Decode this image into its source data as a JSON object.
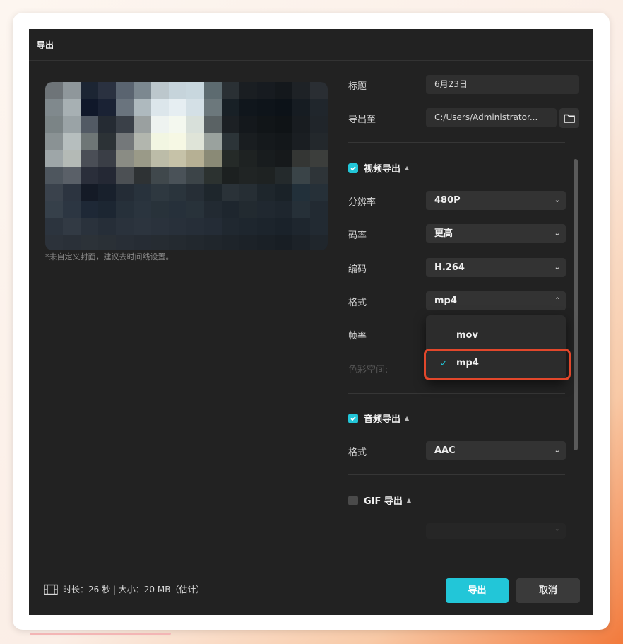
{
  "dialog": {
    "title": "导出"
  },
  "preview": {
    "cover_hint": "*未自定义封面，建议去时间线设置。",
    "pixels": [
      "#6e7478",
      "#8f979b",
      "#1c2533",
      "#2a3140",
      "#5a6470",
      "#7c8890",
      "#bcc7cc",
      "#c6d4db",
      "#c8d7de",
      "#5d6b70",
      "#2a3034",
      "#1a1e22",
      "#171b20",
      "#14181c",
      "#1e2226",
      "#2a2e33",
      "#80898d",
      "#a7b0b3",
      "#10182a",
      "#1a2234",
      "#6a747e",
      "#aeb9be",
      "#dce6eb",
      "#e6eef2",
      "#d4e0e6",
      "#6c787c",
      "#182026",
      "#10161c",
      "#0e141a",
      "#0c1218",
      "#161c22",
      "#20262c",
      "#7b8486",
      "#9aa3a6",
      "#525a64",
      "#252b33",
      "#3a4048",
      "#9aa0a0",
      "#eef3f0",
      "#f4f8ef",
      "#d8e0da",
      "#5a6264",
      "#1c2024",
      "#14181c",
      "#111518",
      "#0f1316",
      "#181c20",
      "#20252a",
      "#8a9294",
      "#b6bebe",
      "#6e7676",
      "#2c3236",
      "#74787a",
      "#b2b6ae",
      "#f2f6e2",
      "#f6f8e4",
      "#dfe4d8",
      "#9aa29e",
      "#2c3438",
      "#191d20",
      "#15191c",
      "#13171a",
      "#1a1e22",
      "#23282c",
      "#9ea6a8",
      "#b4bab6",
      "#4a4e56",
      "#3a3e46",
      "#8a8c84",
      "#9a9a88",
      "#bcbca8",
      "#c6c2a8",
      "#b6b094",
      "#8a8a76",
      "#252a28",
      "#1e2222",
      "#181c1e",
      "#16191b",
      "#343634",
      "#3c3e3c",
      "#4e565e",
      "#5a6068",
      "#2a2e3a",
      "#242834",
      "#4c5054",
      "#2e3234",
      "#40484c",
      "#4a5258",
      "#3c4448",
      "#2c3230",
      "#1c2020",
      "#202424",
      "#1e2222",
      "#242a2c",
      "#3a4448",
      "#2e3438",
      "#3a424c",
      "#2c3440",
      "#141a26",
      "#18202c",
      "#242c36",
      "#28323c",
      "#2e3840",
      "#2a343c",
      "#262e36",
      "#1e262c",
      "#2a3238",
      "#262e34",
      "#1e262c",
      "#1a2228",
      "#22303a",
      "#263038",
      "#36404a",
      "#2c3642",
      "#1e2836",
      "#1c2632",
      "#26303a",
      "#2a343e",
      "#28323a",
      "#26303a",
      "#28323a",
      "#222a32",
      "#1e262e",
      "#222a30",
      "#202830",
      "#1e262e",
      "#263038",
      "#222a32",
      "#2c343e",
      "#323a44",
      "#2a323c",
      "#262e38",
      "#2a323c",
      "#2c343e",
      "#2a323c",
      "#28303a",
      "#262e38",
      "#242c36",
      "#202830",
      "#1e262e",
      "#1c242c",
      "#1a222a",
      "#1e262e",
      "#222a32",
      "#2c323a",
      "#2a3038",
      "#2c3238",
      "#2a3036",
      "#282e36",
      "#262c34",
      "#262c32",
      "#242a30",
      "#22282e",
      "#20262c",
      "#1e242a",
      "#1c2228",
      "#1a2026",
      "#181e24",
      "#1c2228",
      "#20262c"
    ]
  },
  "form": {
    "title_label": "标题",
    "title_value": "6月23日",
    "export_to_label": "导出至",
    "export_to_value": "C:/Users/Administrator...",
    "folder_icon": "folder-icon"
  },
  "video": {
    "header": "视频导出",
    "checked": true,
    "resolution_label": "分辨率",
    "resolution_value": "480P",
    "bitrate_label": "码率",
    "bitrate_value": "更高",
    "codec_label": "编码",
    "codec_value": "H.264",
    "format_label": "格式",
    "format_value": "mp4",
    "framerate_label": "帧率",
    "colorspace_label": "色彩空间:",
    "format_options": [
      "mov",
      "mp4"
    ],
    "format_selected": "mp4"
  },
  "audio": {
    "header": "音频导出",
    "checked": true,
    "format_label": "格式",
    "format_value": "AAC"
  },
  "gif": {
    "header": "GIF 导出",
    "checked": false
  },
  "footer": {
    "info": "时长：26 秒 | 大小：20 MB（估计）",
    "export_button": "导出",
    "cancel_button": "取消"
  },
  "colors": {
    "accent": "#22c6d8",
    "highlight_border": "#e2472b",
    "dialog_bg": "#222222"
  }
}
